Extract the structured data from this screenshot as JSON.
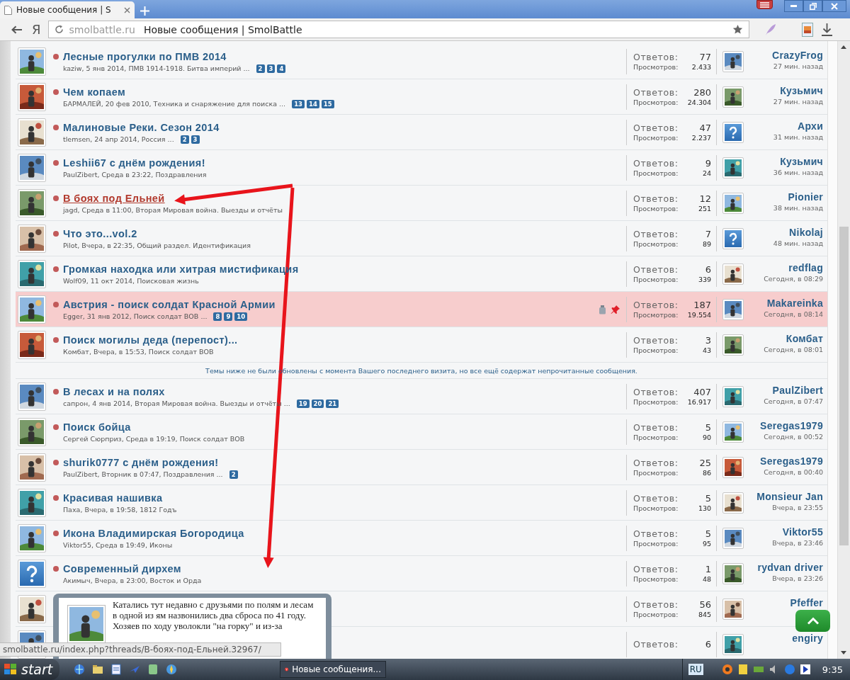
{
  "browser": {
    "tab_title": "Новые сообщения | S",
    "yandex_button": "Я",
    "address_host": "smolbattle.ru",
    "address_title": "Новые сообщения | SmolBattle"
  },
  "threads": [
    {
      "kind": "thread",
      "avatar": {
        "kind": "picture"
      },
      "title": "Лесные прогулки по ПМВ 2014",
      "meta": "kaziw, 5 янв 2014, ПМВ 1914-1918. Битва империй ...",
      "pages": [
        "2",
        "3",
        "4"
      ],
      "hovered": false,
      "sticky": false,
      "replies_label": "Ответов:",
      "replies": "77",
      "views_label": "Просмотров:",
      "views": "2.433",
      "last_avatar": {
        "kind": "picture"
      },
      "last_user": "CrazyFrog",
      "last_time": "27 мин. назад"
    },
    {
      "kind": "thread",
      "avatar": {
        "kind": "picture"
      },
      "title": "Чем копаем",
      "meta": "БАРМАЛЕЙ, 20 фев 2010, Техника и снаряжение для поиска ...",
      "pages": [
        "13",
        "14",
        "15"
      ],
      "hovered": false,
      "sticky": false,
      "replies_label": "Ответов:",
      "replies": "280",
      "views_label": "Просмотров:",
      "views": "24.304",
      "last_avatar": {
        "kind": "picture"
      },
      "last_user": "Кузьмич",
      "last_time": "27 мин. назад"
    },
    {
      "kind": "thread",
      "avatar": {
        "kind": "picture"
      },
      "title": "Малиновые Реки. Сезон 2014",
      "meta": "tlemsen, 24 апр 2014, Россия ...",
      "pages": [
        "2",
        "3"
      ],
      "hovered": false,
      "sticky": false,
      "replies_label": "Ответов:",
      "replies": "47",
      "views_label": "Просмотров:",
      "views": "2.237",
      "last_avatar": {
        "kind": "unknown"
      },
      "last_user": "Архи",
      "last_time": "31 мин. назад"
    },
    {
      "kind": "thread",
      "avatar": {
        "kind": "picture"
      },
      "title": "Leshii67 с днём рождения!",
      "meta": "PaulZibert, Среда в 23:22, Поздравления",
      "hovered": false,
      "sticky": false,
      "replies_label": "Ответов:",
      "replies": "9",
      "views_label": "Просмотров:",
      "views": "24",
      "last_avatar": {
        "kind": "picture"
      },
      "last_user": "Кузьмич",
      "last_time": "36 мин. назад"
    },
    {
      "kind": "thread",
      "avatar": {
        "kind": "picture"
      },
      "title": "В боях под Ельней",
      "meta": "jagd, Среда в 11:00, Вторая Мировая война. Выезды и отчёты",
      "hovered": true,
      "sticky": false,
      "replies_label": "Ответов:",
      "replies": "12",
      "views_label": "Просмотров:",
      "views": "251",
      "last_avatar": {
        "kind": "picture"
      },
      "last_user": "Pionier",
      "last_time": "38 мин. назад"
    },
    {
      "kind": "thread",
      "avatar": {
        "kind": "picture"
      },
      "title": "Что это...vol.2",
      "meta": "Pilot, Вчера, в 22:35, Общий раздел. Идентификация",
      "hovered": false,
      "sticky": false,
      "replies_label": "Ответов:",
      "replies": "7",
      "views_label": "Просмотров:",
      "views": "89",
      "last_avatar": {
        "kind": "unknown"
      },
      "last_user": "Nikolaj",
      "last_time": "48 мин. назад"
    },
    {
      "kind": "thread",
      "avatar": {
        "kind": "picture"
      },
      "title": "Громкая находка или хитрая мистификация",
      "meta": "Wolf09, 11 окт 2014, Поисковая жизнь",
      "hovered": false,
      "sticky": false,
      "replies_label": "Ответов:",
      "replies": "6",
      "views_label": "Просмотров:",
      "views": "339",
      "last_avatar": {
        "kind": "picture"
      },
      "last_user": "redflag",
      "last_time": "Сегодня, в 08:29"
    },
    {
      "kind": "thread",
      "avatar": {
        "kind": "picture"
      },
      "title": "Австрия - поиск солдат Красной Армии",
      "meta": "Egger, 31 янв 2012, Поиск солдат ВОВ ...",
      "pages": [
        "8",
        "9",
        "10"
      ],
      "hovered": false,
      "sticky": true,
      "replies_label": "Ответов:",
      "replies": "187",
      "views_label": "Просмотров:",
      "views": "19.554",
      "last_avatar": {
        "kind": "picture"
      },
      "last_user": "Makareinka",
      "last_time": "Сегодня, в 08:14"
    },
    {
      "kind": "thread",
      "avatar": {
        "kind": "picture"
      },
      "title": "Поиск могилы деда (перепост)...",
      "meta": "Комбат, Вчера, в 15:53, Поиск солдат ВОВ",
      "hovered": false,
      "sticky": false,
      "replies_label": "Ответов:",
      "replies": "3",
      "views_label": "Просмотров:",
      "views": "43",
      "last_avatar": {
        "kind": "picture"
      },
      "last_user": "Комбат",
      "last_time": "Сегодня, в 08:01"
    },
    {
      "kind": "notice",
      "text": "Темы ниже не были обновлены с момента Вашего последнего визита, но все ещё содержат непрочитанные сообщения."
    },
    {
      "kind": "thread",
      "avatar": {
        "kind": "picture"
      },
      "title": "В лесах и на полях",
      "meta": "сапрон, 4 янв 2014, Вторая Мировая война. Выезды и отчёты ...",
      "pages": [
        "19",
        "20",
        "21"
      ],
      "hovered": false,
      "sticky": false,
      "replies_label": "Ответов:",
      "replies": "407",
      "views_label": "Просмотров:",
      "views": "16.917",
      "last_avatar": {
        "kind": "picture"
      },
      "last_user": "PaulZibert",
      "last_time": "Сегодня, в 07:47"
    },
    {
      "kind": "thread",
      "avatar": {
        "kind": "picture"
      },
      "title": "Поиск бойца",
      "meta": "Сергей Сюрприз, Среда в 19:19, Поиск солдат ВОВ",
      "hovered": false,
      "sticky": false,
      "replies_label": "Ответов:",
      "replies": "5",
      "views_label": "Просмотров:",
      "views": "90",
      "last_avatar": {
        "kind": "picture"
      },
      "last_user": "Seregas1979",
      "last_time": "Сегодня, в 00:52"
    },
    {
      "kind": "thread",
      "avatar": {
        "kind": "picture"
      },
      "title": "shurik0777 с днём рождения!",
      "meta": "PaulZibert, Вторник в 07:47, Поздравления ...",
      "pages": [
        "2"
      ],
      "hovered": false,
      "sticky": false,
      "replies_label": "Ответов:",
      "replies": "25",
      "views_label": "Просмотров:",
      "views": "86",
      "last_avatar": {
        "kind": "picture"
      },
      "last_user": "Seregas1979",
      "last_time": "Сегодня, в 00:40"
    },
    {
      "kind": "thread",
      "avatar": {
        "kind": "picture"
      },
      "title": "Красивая нашивка",
      "meta": "Паха, Вчера, в 19:58, 1812 Годъ",
      "hovered": false,
      "sticky": false,
      "replies_label": "Ответов:",
      "replies": "5",
      "views_label": "Просмотров:",
      "views": "130",
      "last_avatar": {
        "kind": "picture"
      },
      "last_user": "Monsieur Jan",
      "last_time": "Вчера, в 23:55"
    },
    {
      "kind": "thread",
      "avatar": {
        "kind": "picture"
      },
      "title": "Икона Владимирская Богородица",
      "meta": "Viktor55, Среда в 19:49, Иконы",
      "hovered": false,
      "sticky": false,
      "replies_label": "Ответов:",
      "replies": "5",
      "views_label": "Просмотров:",
      "views": "95",
      "last_avatar": {
        "kind": "picture"
      },
      "last_user": "Viktor55",
      "last_time": "Вчера, в 23:46"
    },
    {
      "kind": "thread",
      "avatar": {
        "kind": "unknown"
      },
      "title": "Современный дирхем",
      "meta": "Акимыч, Вчера, в 23:00, Восток и Орда",
      "hovered": false,
      "sticky": false,
      "replies_label": "Ответов:",
      "replies": "1",
      "views_label": "Просмотров:",
      "views": "48",
      "last_avatar": {
        "kind": "picture"
      },
      "last_user": "rydvan driver",
      "last_time": "Вчера, в 23:26"
    },
    {
      "kind": "thread",
      "avatar": {
        "kind": "picture"
      },
      "sticky": false,
      "replies_label": "Ответов:",
      "replies": "56",
      "views_label": "Просмотров:",
      "views": "845",
      "last_avatar": {
        "kind": "picture"
      },
      "last_user": "Pfeffer"
    },
    {
      "kind": "thread",
      "avatar": {
        "kind": "picture"
      },
      "sticky": false,
      "replies_label": "Ответов:",
      "replies": "6",
      "last_avatar": {
        "kind": "picture"
      },
      "last_user": "engiry"
    }
  ],
  "preview": {
    "paragraphs": [
      "Катались тут недавно с друзьями по полям и лесам в одной из ям назвонились два сброса по 41 году.",
      "Хозяев по ходу уволокли \"на горку\" и из-за"
    ]
  },
  "status_url": "smolbattle.ru/index.php?threads/В-боях-под-Ельней.32967/",
  "taskbar": {
    "start": "start",
    "task": "Новые сообщения...",
    "language": "RU",
    "clock": "9:35"
  }
}
